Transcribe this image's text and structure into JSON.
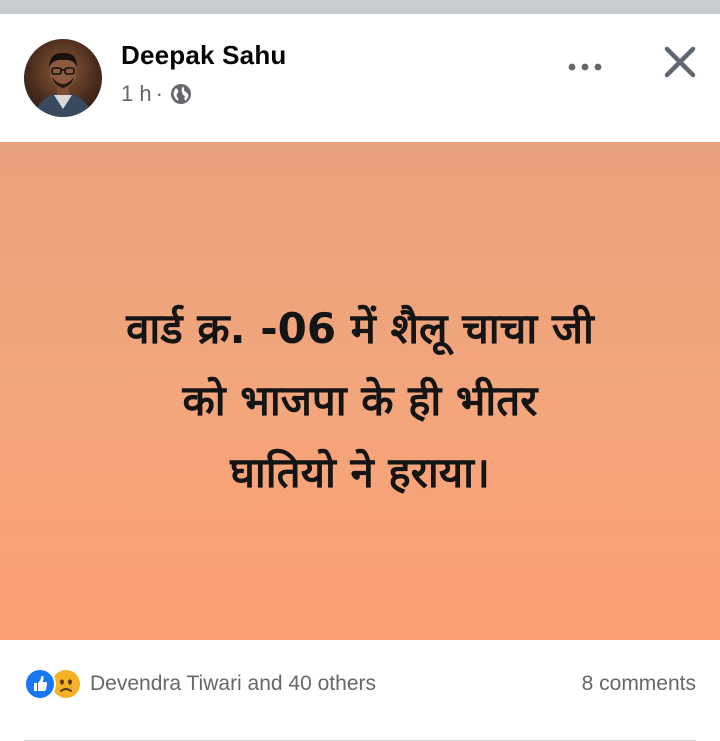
{
  "post": {
    "author": "Deepak Sahu",
    "time": "1 h",
    "separator": "·",
    "privacy_icon": "globe-icon",
    "text": "वार्ड क्र. -06 में शैलू चाचा जी\nको भाजपा के ही भीतर\nघातियो ने हराया।",
    "background_colors": [
      "#e9a07c",
      "#fb9f72"
    ]
  },
  "header": {
    "more_icon": "more-dots-icon",
    "close_icon": "close-icon"
  },
  "footer": {
    "reactions_text": "Devendra Tiwari and 40 others",
    "reaction_icons": [
      "like-icon",
      "sad-icon"
    ],
    "comments": "8 comments"
  },
  "colors": {
    "like_blue": "#1877f2",
    "sad_yellow": "#f7b125",
    "secondary_text": "#65676b"
  }
}
